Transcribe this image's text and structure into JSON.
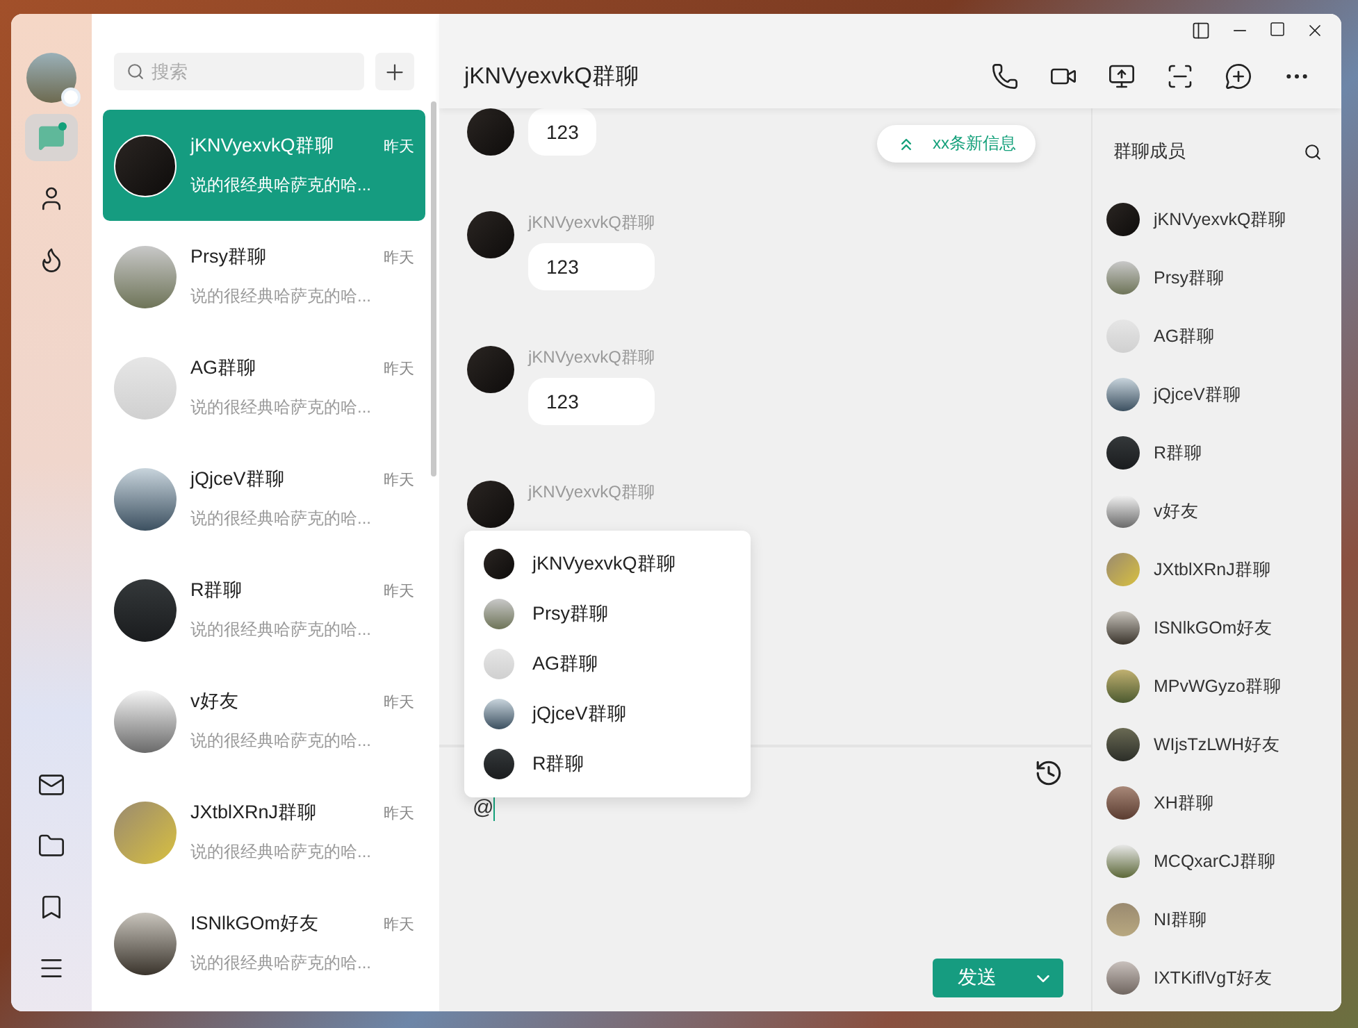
{
  "nav": {
    "top": [
      {
        "kind": "chat",
        "selected": true
      },
      {
        "kind": "contacts",
        "selected": false
      },
      {
        "kind": "fire",
        "selected": false
      }
    ],
    "bottom": [
      {
        "kind": "mail"
      },
      {
        "kind": "folder"
      },
      {
        "kind": "bookmark"
      },
      {
        "kind": "menu"
      }
    ]
  },
  "chat_list": {
    "search": {
      "placeholder": "搜索"
    },
    "items": [
      {
        "name": "jKNVyexvkQ群聊",
        "time": "昨天",
        "preview": "说的很经典哈萨克的哈...",
        "selected": true
      },
      {
        "name": "Prsy群聊",
        "time": "昨天",
        "preview": "说的很经典哈萨克的哈...",
        "selected": false
      },
      {
        "name": "AG群聊",
        "time": "昨天",
        "preview": "说的很经典哈萨克的哈...",
        "selected": false
      },
      {
        "name": "jQjceV群聊",
        "time": "昨天",
        "preview": "说的很经典哈萨克的哈...",
        "selected": false
      },
      {
        "name": "R群聊",
        "time": "昨天",
        "preview": "说的很经典哈萨克的哈...",
        "selected": false
      },
      {
        "name": "v好友",
        "time": "昨天",
        "preview": "说的很经典哈萨克的哈...",
        "selected": false
      },
      {
        "name": "JXtblXRnJ群聊",
        "time": "昨天",
        "preview": "说的很经典哈萨克的哈...",
        "selected": false
      },
      {
        "name": "ISNlkGOm好友",
        "time": "昨天",
        "preview": "说的很经典哈萨克的哈...",
        "selected": false
      }
    ]
  },
  "conversation": {
    "title": "jKNVyexvkQ群聊",
    "new_messages": "xx条新信息",
    "messages": [
      {
        "text": "123"
      },
      {
        "sender": "jKNVyexvkQ群聊",
        "text": "123"
      },
      {
        "sender": "jKNVyexvkQ群聊",
        "text": "123"
      },
      {
        "sender": "jKNVyexvkQ群聊"
      }
    ],
    "mention_menu": [
      "jKNVyexvkQ群聊",
      "Prsy群聊",
      "AG群聊",
      "jQjceV群聊",
      "R群聊"
    ],
    "input": {
      "value": "@"
    },
    "send_button": "发送"
  },
  "members": {
    "title": "群聊成员",
    "items": [
      "jKNVyexvkQ群聊",
      "Prsy群聊",
      "AG群聊",
      "jQjceV群聊",
      "R群聊",
      "v好友",
      "JXtblXRnJ群聊",
      "ISNlkGOm好友",
      "MPvWGyzo群聊",
      "WIjsTzLWH好友",
      "XH群聊",
      "MCQxarCJ群聊",
      "NI群聊",
      "IXTKiflVgT好友"
    ]
  }
}
